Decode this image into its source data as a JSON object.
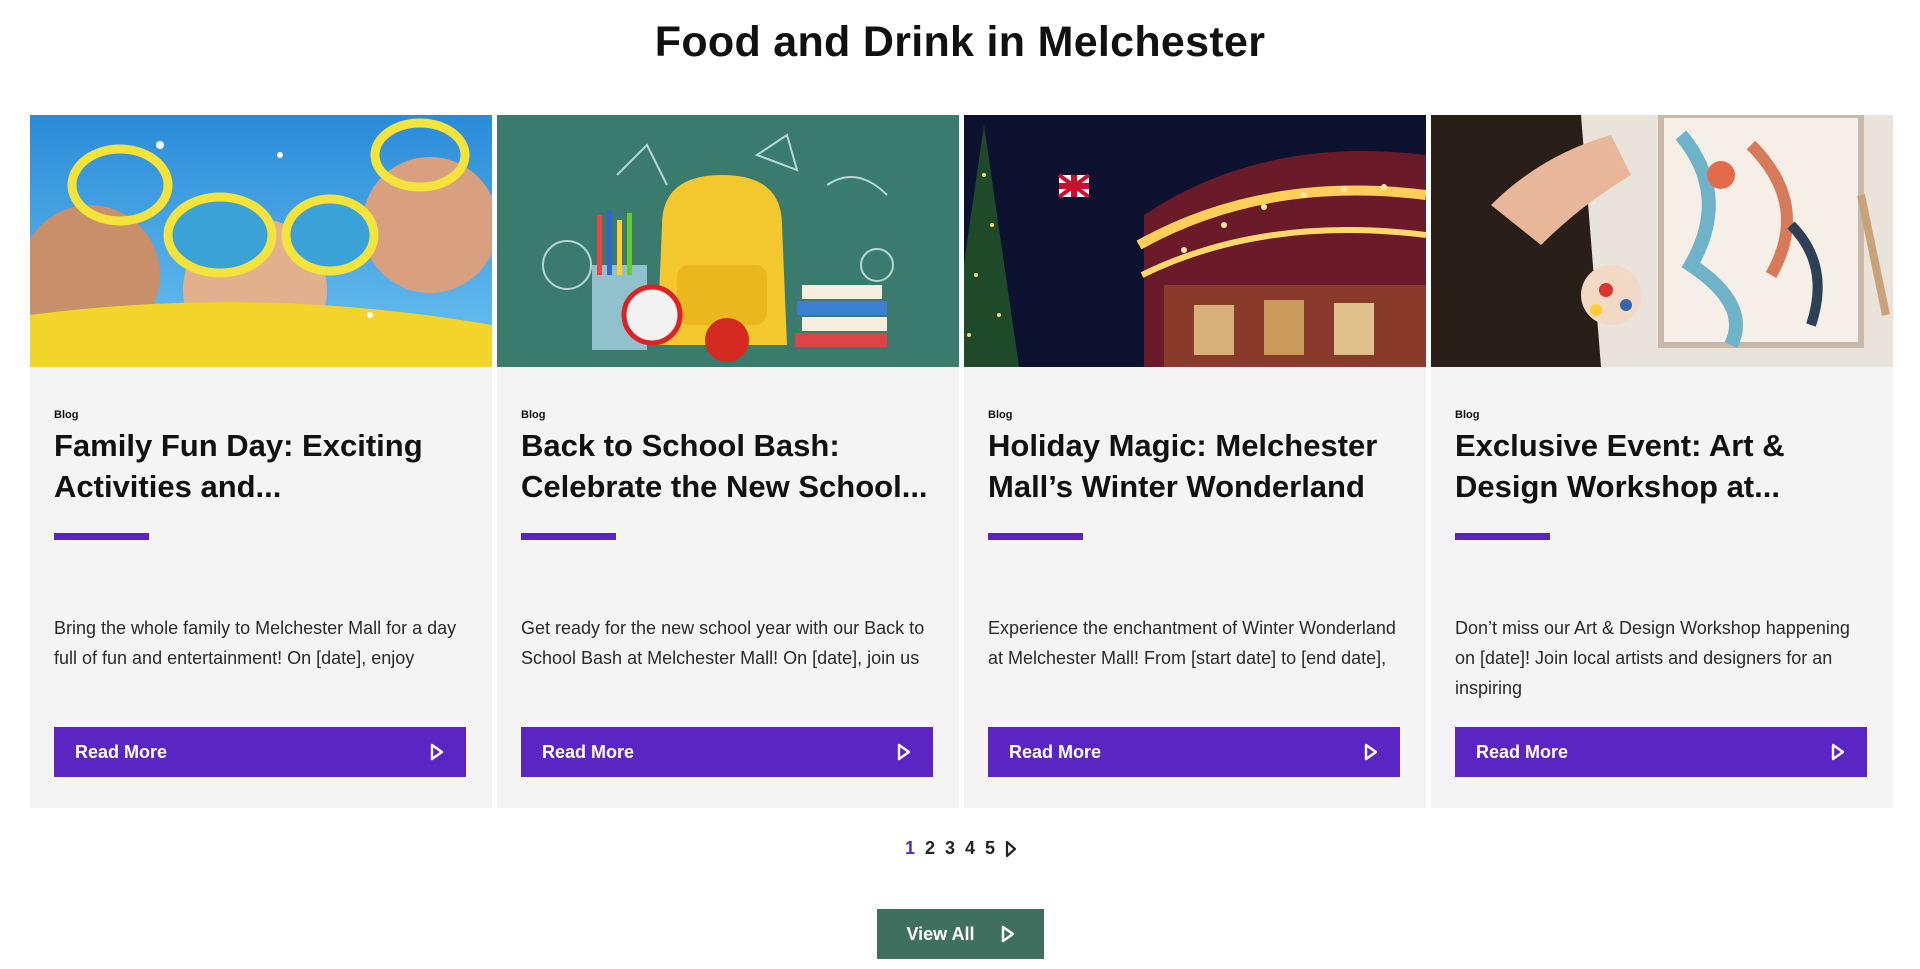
{
  "section": {
    "title": "Food and Drink in Melchester"
  },
  "cards": [
    {
      "tag": "Blog",
      "title": "Family Fun Day: Exciting Activities and...",
      "excerpt": "Bring the whole family to Melchester Mall for a day full of fun and entertainment! On [date], enjoy",
      "button": "Read More",
      "image_icon": "family-sunglasses-photo"
    },
    {
      "tag": "Blog",
      "title": "Back to School Bash: Celebrate the New School...",
      "excerpt": "Get ready for the new school year with our Back to School Bash at Melchester Mall! On [date], join us",
      "button": "Read More",
      "image_icon": "school-backpack-photo"
    },
    {
      "tag": "Blog",
      "title": "Holiday Magic: Melchester Mall’s Winter Wonderland",
      "excerpt": "Experience the enchantment of Winter Wonderland at Melchester Mall! From [start date] to [end date],",
      "button": "Read More",
      "image_icon": "carousel-night-photo"
    },
    {
      "tag": "Blog",
      "title": "Exclusive Event: Art & Design Workshop at...",
      "excerpt": "Don’t miss our Art & Design Workshop happening on [date]! Join local artists and designers for an inspiring",
      "button": "Read More",
      "image_icon": "painting-workshop-photo"
    }
  ],
  "pagination": {
    "pages": [
      "1",
      "2",
      "3",
      "4",
      "5"
    ],
    "current": "1",
    "next_icon": "play-icon"
  },
  "view_all": {
    "label": "View All",
    "icon": "play-icon"
  },
  "colors": {
    "accent": "#5b25c4",
    "view_all_bg": "#3f6f5e",
    "card_bg": "#f4f4f4"
  }
}
